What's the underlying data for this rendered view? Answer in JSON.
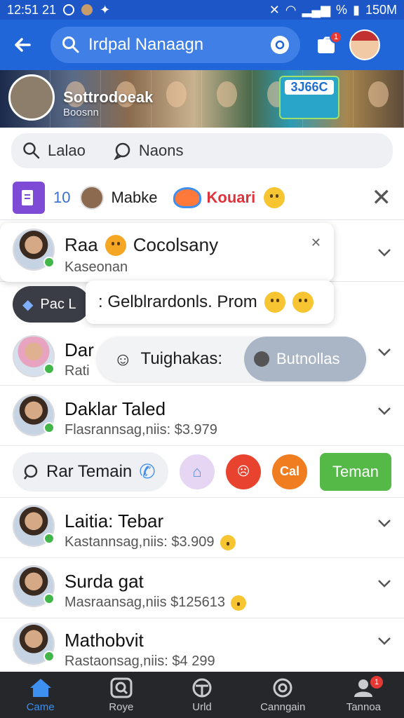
{
  "status_bar": {
    "time": "12:51 21",
    "battery_text": "150M",
    "battery_pct_symbol": "%"
  },
  "header": {
    "search_query": "Irdpal Nanaagn",
    "notification_count": "1"
  },
  "banner": {
    "name": "Sottrodoeak",
    "subtitle": "Boosnn",
    "card_label": "",
    "card_value": "3J66C"
  },
  "subsearch": {
    "items": [
      {
        "label": "Lalao",
        "icon": "search-icon"
      },
      {
        "label": "Naons",
        "icon": "chat-bubble-icon"
      }
    ]
  },
  "chiprow": {
    "count": "10",
    "name": "Mabke",
    "tag": "Kouari"
  },
  "popup1": {
    "title": "Raa",
    "title2": "Cocolsany",
    "subtitle": "Kaseonan"
  },
  "pill_dark": {
    "label": "Pac L"
  },
  "popup2": {
    "text": ": Gelblrardonls. Prom"
  },
  "popup3": {
    "text": "Tuighakas:",
    "button": "Butnollas"
  },
  "contacts": [
    {
      "name": "Dar",
      "sub": "Rati"
    },
    {
      "name": "Daklar Taled",
      "sub": "Flasrannsag,niis: $3.979"
    },
    {
      "name": "Laitia: Tebar",
      "sub": "Kastannsag,niis: $3.909"
    },
    {
      "name": "Surda gat",
      "sub": "Masraansag,niis $125613"
    },
    {
      "name": "Mathobvit",
      "sub": "Rastaonsag,niis: $4 299"
    }
  ],
  "actionrow": {
    "search_label": "Rar Temain",
    "circle_text": "Cal",
    "primary_button": "Teman"
  },
  "bottom_nav": {
    "items": [
      {
        "label": "Came",
        "icon": "home-icon",
        "active": true
      },
      {
        "label": "Roye",
        "icon": "search-icon",
        "active": false
      },
      {
        "label": "Urld",
        "icon": "globe-icon",
        "active": false
      },
      {
        "label": "Canngain",
        "icon": "circle-icon",
        "active": false
      },
      {
        "label": "Tannoa",
        "icon": "profile-icon",
        "active": false,
        "badge": "1"
      }
    ]
  },
  "colors": {
    "brand_blue": "#2166d8",
    "accent_green": "#55b948",
    "online_green": "#43b649",
    "badge_red": "#e53935"
  }
}
